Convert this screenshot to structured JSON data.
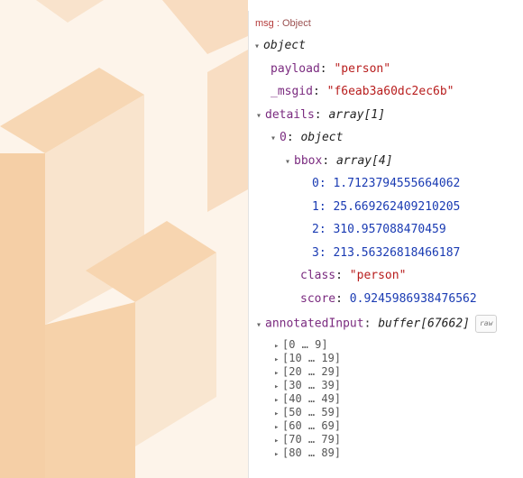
{
  "debug": {
    "topic": "msg",
    "topic_type": "Object",
    "root_type": "object",
    "payload": {
      "key": "payload",
      "value": "\"person\""
    },
    "msgid": {
      "key": "_msgid",
      "value": "\"f6eab3a60dc2ec6b\""
    },
    "details": {
      "key": "details",
      "type": "array[1]"
    },
    "item0": {
      "key": "0",
      "type": "object"
    },
    "bbox": {
      "key": "bbox",
      "type": "array[4]",
      "values": [
        {
          "i": "0",
          "v": "1.7123794555664062"
        },
        {
          "i": "1",
          "v": "25.669262409210205"
        },
        {
          "i": "2",
          "v": "310.957088470459"
        },
        {
          "i": "3",
          "v": "213.56326818466187"
        }
      ]
    },
    "class": {
      "key": "class",
      "value": "\"person\""
    },
    "score": {
      "key": "score",
      "value": "0.9245986938476562"
    },
    "annotated": {
      "key": "annotatedInput",
      "type": "buffer[67662]",
      "raw_label": "raw"
    },
    "ranges": [
      "[0 … 9]",
      "[10 … 19]",
      "[20 … 29]",
      "[30 … 39]",
      "[40 … 49]",
      "[50 … 59]",
      "[60 … 69]",
      "[70 … 79]",
      "[80 … 89]"
    ]
  },
  "colors": {
    "logo": "#f9e2c4",
    "logo_dark": "#f4d2a8"
  }
}
